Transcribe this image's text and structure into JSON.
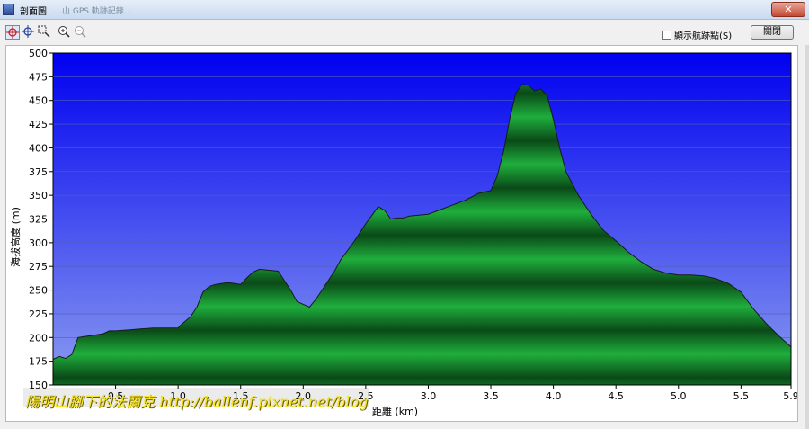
{
  "window": {
    "title": "剖面圖",
    "title_blur": "…山 GPS 軌跡記錄…",
    "close_glyph": "✕"
  },
  "toolbar": {
    "icons": [
      "crosshair-select-icon",
      "crosshair-icon",
      "zoom-area-icon",
      "zoom-in-icon",
      "zoom-out-icon"
    ],
    "show_trackpoints_label": "顯示航跡點(S)",
    "show_trackpoints_checked": false,
    "close_button_label": "關閉"
  },
  "watermark": {
    "text": "陽明山腳下的法蘭克 http://ballenf.pixnet.net/blog"
  },
  "colors": {
    "sky_top": "#0000f0",
    "sky_bottom": "#8a9cf0",
    "fill_light": "#1fae3c",
    "fill_dark": "#0a4a18",
    "outline": "#1a1a1a",
    "grid": "#5060b8"
  },
  "chart_data": {
    "type": "area",
    "xlabel": "距離 (km)",
    "ylabel": "海拔高度 (m)",
    "xlim": [
      0,
      5.9
    ],
    "ylim": [
      150,
      500
    ],
    "yticks": [
      150,
      175,
      200,
      225,
      250,
      275,
      300,
      325,
      350,
      375,
      400,
      425,
      450,
      475,
      500
    ],
    "xticks": [
      {
        "value": 0.5,
        "label": "0.5"
      },
      {
        "value": 1.0,
        "label": "1.0"
      },
      {
        "value": 1.5,
        "label": "1.5"
      },
      {
        "value": 2.0,
        "label": "2.0"
      },
      {
        "value": 2.5,
        "label": "2.5"
      },
      {
        "value": 3.0,
        "label": "3.0"
      },
      {
        "value": 3.5,
        "label": "3.5"
      },
      {
        "value": 4.0,
        "label": "4.0"
      },
      {
        "value": 4.5,
        "label": "4.5"
      },
      {
        "value": 5.0,
        "label": "5.0"
      },
      {
        "value": 5.5,
        "label": "5.5"
      },
      {
        "value": 5.9,
        "label": "5.9"
      }
    ],
    "grid": true,
    "series": [
      {
        "x": [
          0.0,
          0.05,
          0.1,
          0.15,
          0.2,
          0.3,
          0.4,
          0.45,
          0.5,
          0.6,
          0.7,
          0.8,
          0.9,
          1.0,
          1.02,
          1.1,
          1.15,
          1.2,
          1.25,
          1.3,
          1.4,
          1.5,
          1.55,
          1.6,
          1.65,
          1.8,
          1.85,
          1.9,
          1.95,
          2.0,
          2.05,
          2.1,
          2.15,
          2.2,
          2.25,
          2.3,
          2.4,
          2.5,
          2.6,
          2.65,
          2.7,
          2.75,
          2.8,
          2.85,
          3.0,
          3.1,
          3.2,
          3.3,
          3.4,
          3.5,
          3.55,
          3.6,
          3.65,
          3.7,
          3.75,
          3.8,
          3.85,
          3.9,
          3.95,
          4.0,
          4.05,
          4.1,
          4.2,
          4.3,
          4.4,
          4.5,
          4.6,
          4.7,
          4.8,
          4.9,
          5.0,
          5.1,
          5.2,
          5.3,
          5.4,
          5.5,
          5.6,
          5.7,
          5.8,
          5.9
        ],
        "y": [
          177,
          180,
          178,
          182,
          200,
          202,
          204,
          207,
          207,
          208,
          209,
          210,
          210,
          210,
          213,
          222,
          232,
          248,
          254,
          256,
          258,
          256,
          263,
          269,
          272,
          270,
          260,
          250,
          238,
          235,
          232,
          240,
          250,
          260,
          270,
          282,
          300,
          320,
          338,
          334,
          325,
          326,
          326,
          328,
          330,
          335,
          340,
          345,
          352,
          355,
          370,
          395,
          430,
          458,
          467,
          466,
          460,
          462,
          455,
          430,
          400,
          375,
          350,
          330,
          313,
          302,
          290,
          280,
          272,
          268,
          266,
          266,
          265,
          262,
          257,
          248,
          230,
          215,
          202,
          190
        ]
      }
    ]
  }
}
